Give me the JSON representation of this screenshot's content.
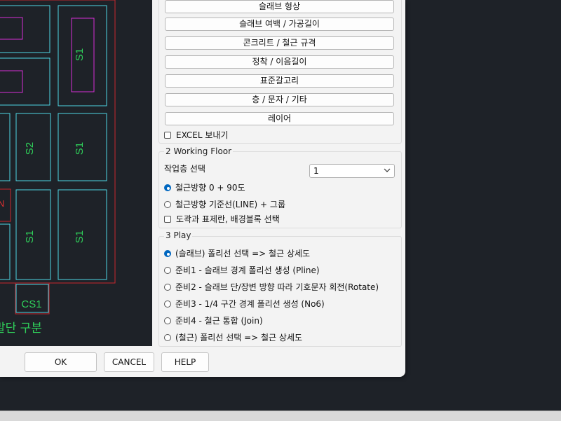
{
  "cad": {
    "labels": [
      "S1",
      "S2",
      "S1",
      "S1",
      "S1",
      "CS1",
      "N"
    ],
    "caption": "말단 구분"
  },
  "buttons": [
    "슬래브 형상",
    "슬래브 여백 / 가공길이",
    "콘크리트 / 철근 규격",
    "정착 / 이음길이",
    "표준갈고리",
    "층 / 문자 / 기타",
    "레이어"
  ],
  "excel_label": "EXCEL 보내기",
  "working_floor": {
    "title": "2 Working  Floor",
    "select_label": "작업층 선택",
    "select_value": "1",
    "radio1": "철근방향 0 + 90도",
    "radio2": "철근방향 기준선(LINE) + 그룹",
    "check": "도곽과 표제란, 배경블록 선택"
  },
  "play": {
    "title": "3 Play",
    "items": [
      "(슬래브) 폴리선 선택 =>  철근 상세도",
      "준비1 - 슬래브 경계 폴리선 생성 (Pline)",
      "준비2 - 슬래브 단/장변 방향 따라 기호문자 회전(Rotate)",
      "준비3 - 1/4 구간 경계 폴리선 생성 (No6)",
      "준비4 - 철근 통합 (Join)",
      "(철근) 폴리선 선택 =>  철근 상세도"
    ]
  },
  "footer": {
    "ok": "OK",
    "cancel": "CANCEL",
    "help": "HELP"
  }
}
